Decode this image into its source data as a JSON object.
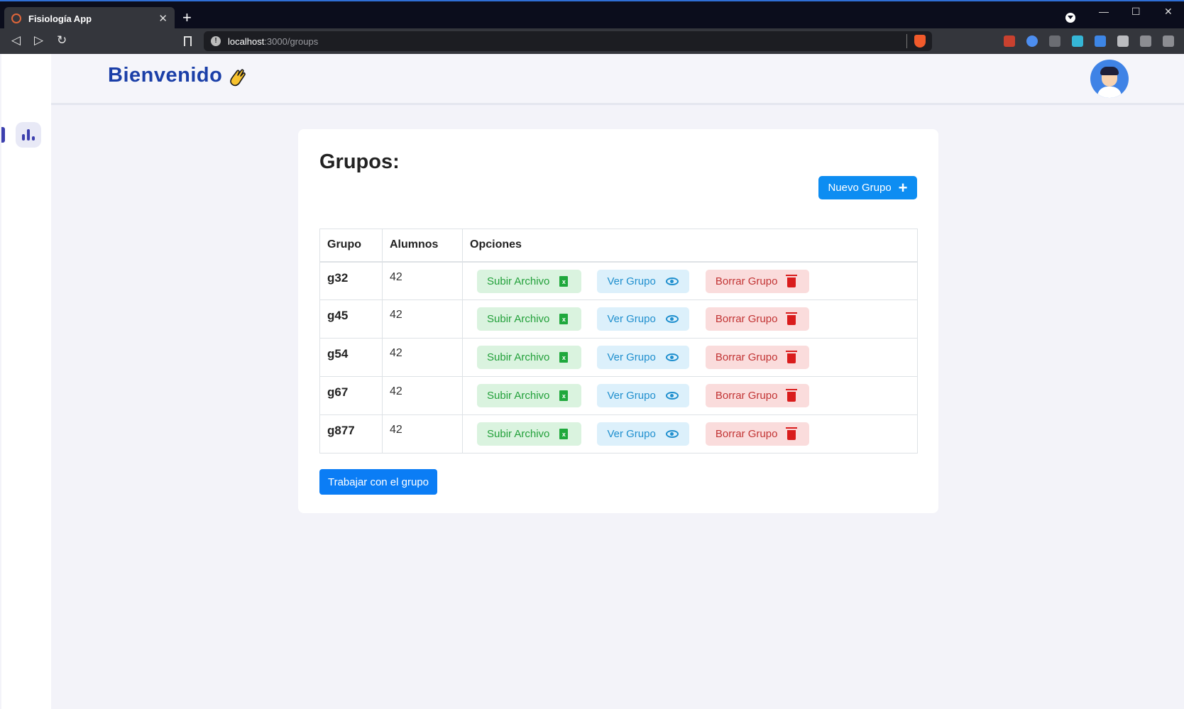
{
  "browser": {
    "tab_title": "Fisiología App",
    "tab_close": "✕",
    "new_tab": "+",
    "url_host": "localhost",
    "url_path": ":3000/groups",
    "window_minimize": "—",
    "window_maximize": "☐",
    "window_close": "✕",
    "nav_back": "◁",
    "nav_forward": "▷",
    "nav_reload": "↻"
  },
  "header": {
    "welcome": "Bienvenido",
    "wave_icon": "waving-hand-icon",
    "avatar_icon": "user-avatar-icon"
  },
  "sidebar": {
    "items": [
      {
        "icon": "bar-chart-icon",
        "active": true
      }
    ]
  },
  "main": {
    "title": "Grupos:",
    "new_group_label": "Nuevo Grupo",
    "new_group_icon": "+",
    "table": {
      "headers": [
        "Grupo",
        "Alumnos",
        "Opciones"
      ],
      "rows": [
        {
          "grupo": "g32",
          "alumnos": "42"
        },
        {
          "grupo": "g45",
          "alumnos": "42"
        },
        {
          "grupo": "g54",
          "alumnos": "42"
        },
        {
          "grupo": "g67",
          "alumnos": "42"
        },
        {
          "grupo": "g877",
          "alumnos": "42"
        }
      ],
      "actions": {
        "upload": "Subir Archivo",
        "view": "Ver Grupo",
        "delete": "Borrar Grupo"
      }
    },
    "work_label": "Trabajar con el grupo"
  },
  "colors": {
    "accent": "#0d8df2",
    "brand": "#1b3fa8",
    "upload": "#22a03a",
    "view": "#1f8fce",
    "delete": "#c23434"
  }
}
